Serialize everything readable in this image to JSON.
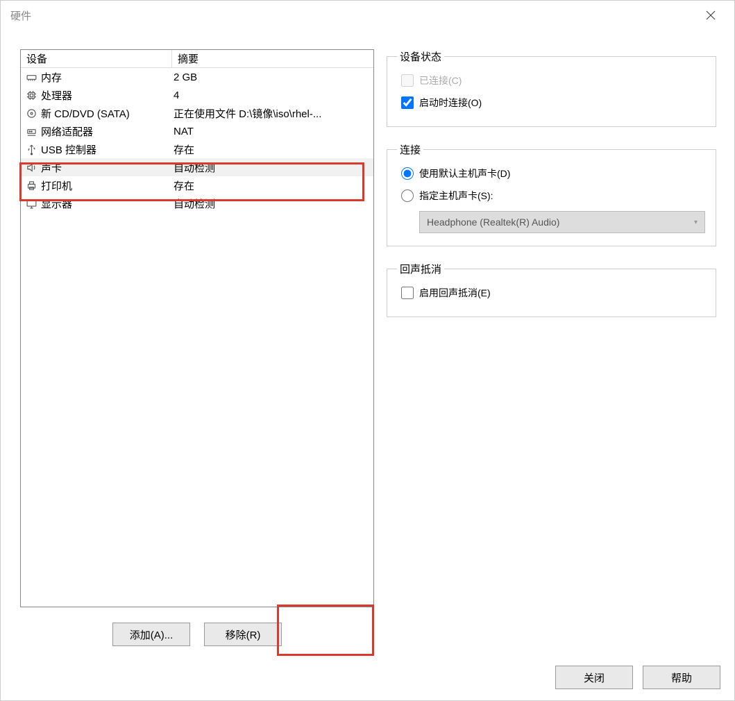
{
  "title": "硬件",
  "list": {
    "header_device": "设备",
    "header_summary": "摘要",
    "rows": [
      {
        "icon": "memory",
        "name": "内存",
        "summary": "2 GB",
        "selected": false
      },
      {
        "icon": "cpu",
        "name": "处理器",
        "summary": "4",
        "selected": false
      },
      {
        "icon": "disc",
        "name": "新 CD/DVD (SATA)",
        "summary": "正在使用文件 D:\\镜像\\iso\\rhel-...",
        "selected": false
      },
      {
        "icon": "network",
        "name": "网络适配器",
        "summary": "NAT",
        "selected": false
      },
      {
        "icon": "usb",
        "name": "USB 控制器",
        "summary": "存在",
        "selected": false
      },
      {
        "icon": "sound",
        "name": "声卡",
        "summary": "自动检测",
        "selected": true
      },
      {
        "icon": "printer",
        "name": "打印机",
        "summary": "存在",
        "selected": false
      },
      {
        "icon": "display",
        "name": "显示器",
        "summary": "自动检测",
        "selected": false
      }
    ]
  },
  "buttons": {
    "add": "添加(A)...",
    "remove": "移除(R)",
    "close": "关闭",
    "help": "帮助"
  },
  "device_status": {
    "legend": "设备状态",
    "connected": "已连接(C)",
    "connect_at_power": "启动时连接(O)",
    "connected_checked": false,
    "connected_enabled": false,
    "connect_at_power_checked": true
  },
  "connection": {
    "legend": "连接",
    "use_default": "使用默认主机声卡(D)",
    "specify_host": "指定主机声卡(S):",
    "selected": "use_default",
    "combo_value": "Headphone (Realtek(R) Audio)"
  },
  "echo": {
    "legend": "回声抵消",
    "enable": "启用回声抵消(E)",
    "checked": false
  }
}
